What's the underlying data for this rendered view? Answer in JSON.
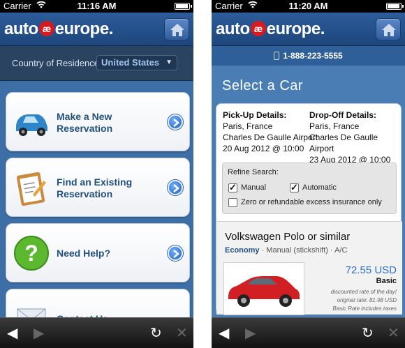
{
  "screen1": {
    "status": {
      "carrier": "Carrier",
      "time": "11:16 AM"
    },
    "logo": {
      "left": "auto",
      "mark": "æ",
      "right": "europe."
    },
    "country": {
      "label": "Country of Residence:",
      "value": "United States"
    },
    "cards": [
      {
        "label": "Make a New Reservation",
        "icon": "car-icon"
      },
      {
        "label": "Find an Existing Reservation",
        "icon": "clipboard-icon"
      },
      {
        "label": "Need Help?",
        "icon": "help-icon"
      },
      {
        "label": "Contact Us",
        "icon": "mail-icon"
      }
    ]
  },
  "screen2": {
    "status": {
      "carrier": "Carrier",
      "time": "11:20 AM"
    },
    "logo": {
      "left": "auto",
      "mark": "æ",
      "right": "europe."
    },
    "phone": "1-888-223-5555",
    "title": "Select a Car",
    "pickup": {
      "heading": "Pick-Up Details:",
      "city": "Paris, France",
      "place": "Charles De Gaulle Airport",
      "datetime": "20 Aug 2012 @ 10:00"
    },
    "dropoff": {
      "heading": "Drop-Off Details:",
      "city": "Paris, France",
      "place": "Charles De Gaulle Airport",
      "datetime": "23 Aug 2012 @ 10:00"
    },
    "refine": {
      "heading": "Refine Search:",
      "manual": "Manual",
      "automatic": "Automatic",
      "insurance": "Zero or refundable excess insurance only"
    },
    "car": {
      "name": "Volkswagen Polo or similar",
      "class": "Economy",
      "meta": " · Manual (stickshift) · A/C",
      "price": "72.55 USD",
      "rate_type": "Basic",
      "note1": "discounted rate of the day!",
      "note2": "original rate: 81.98 USD",
      "note3": "Basic Rate includes taxes"
    }
  },
  "colors": {
    "brand_blue": "#2d5d9c",
    "accent_red": "#d71920",
    "link_blue": "#23507f"
  }
}
